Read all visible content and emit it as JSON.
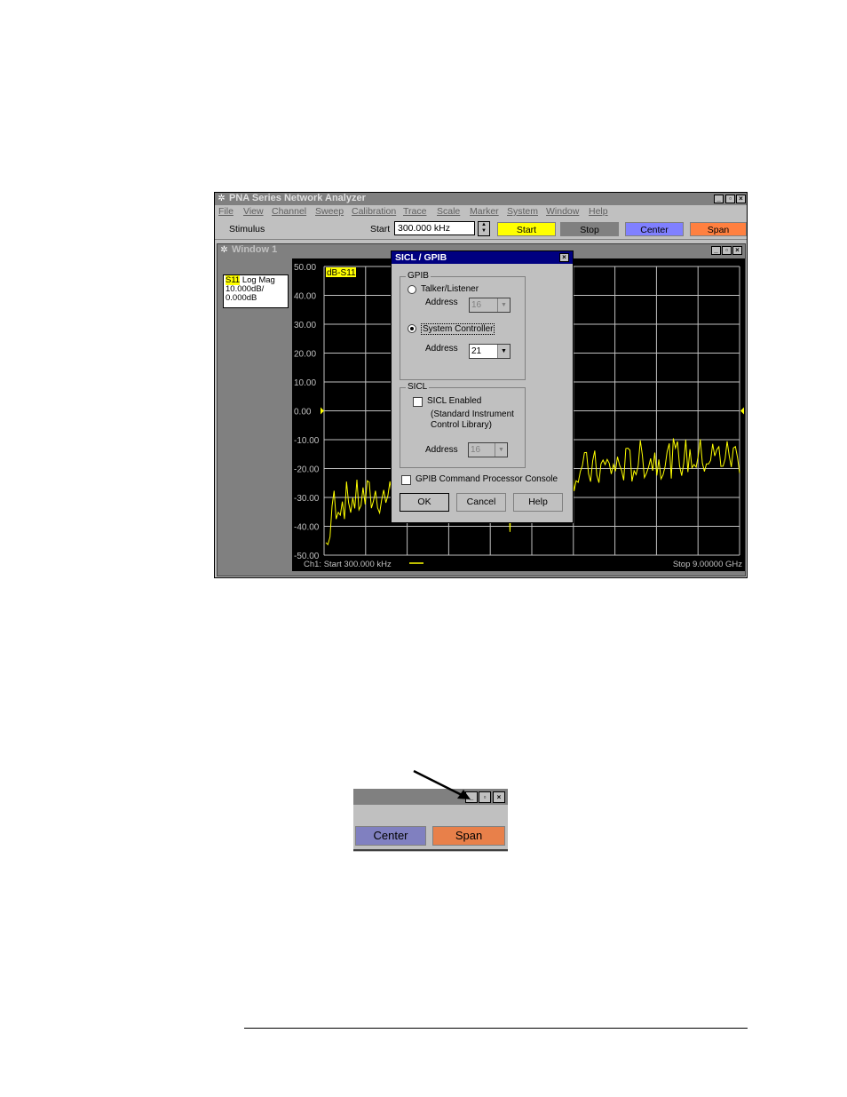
{
  "app": {
    "title": "PNA Series Network Analyzer",
    "menu": [
      "File",
      "View",
      "Channel",
      "Sweep",
      "Calibration",
      "Trace",
      "Scale",
      "Marker",
      "System",
      "Window",
      "Help"
    ]
  },
  "toolbar": {
    "stimulus_label": "Stimulus",
    "start_label": "Start",
    "start_value": "300.000 kHz",
    "buttons": [
      {
        "label": "Start",
        "color": "#ffff00"
      },
      {
        "label": "Stop",
        "color": "#808080"
      },
      {
        "label": "Center",
        "color": "#8080ff"
      },
      {
        "label": "Span",
        "color": "#ff8040"
      }
    ]
  },
  "document_window": {
    "title": "Window 1",
    "trace_label": {
      "param": "S11",
      "format": "Log Mag",
      "scale": "10.000dB/",
      "ref": "0.000dB"
    },
    "marker_tag": "dB-S11",
    "footer_left": "Ch1: Start  300.000 kHz",
    "footer_right": "Stop  9.00000 GHz"
  },
  "chart_data": {
    "type": "line",
    "ylim": [
      -50,
      50
    ],
    "y_ticks": [
      "50.00",
      "40.00",
      "30.00",
      "20.00",
      "10.00",
      "0.00",
      "-10.00",
      "-20.00",
      "-30.00",
      "-40.00",
      "-50.00"
    ],
    "x_range_text": [
      "300.000 kHz",
      "9.00000 GHz"
    ],
    "grid": true,
    "trace_color": "#ffff00"
  },
  "dialog": {
    "title": "SICL / GPIB",
    "gpib_group": "GPIB",
    "talker_listener": "Talker/Listener",
    "address_label": "Address",
    "talker_address": "16",
    "system_controller": "System Controller",
    "controller_address": "21",
    "sicl_group": "SICL",
    "sicl_enabled": "SICL Enabled",
    "sicl_desc1": "(Standard Instrument",
    "sicl_desc2": "Control Library)",
    "sicl_address": "16",
    "console": "GPIB Command Processor Console",
    "ok": "OK",
    "cancel": "Cancel",
    "help": "Help"
  },
  "inset": {
    "center": "Center",
    "span": "Span"
  }
}
